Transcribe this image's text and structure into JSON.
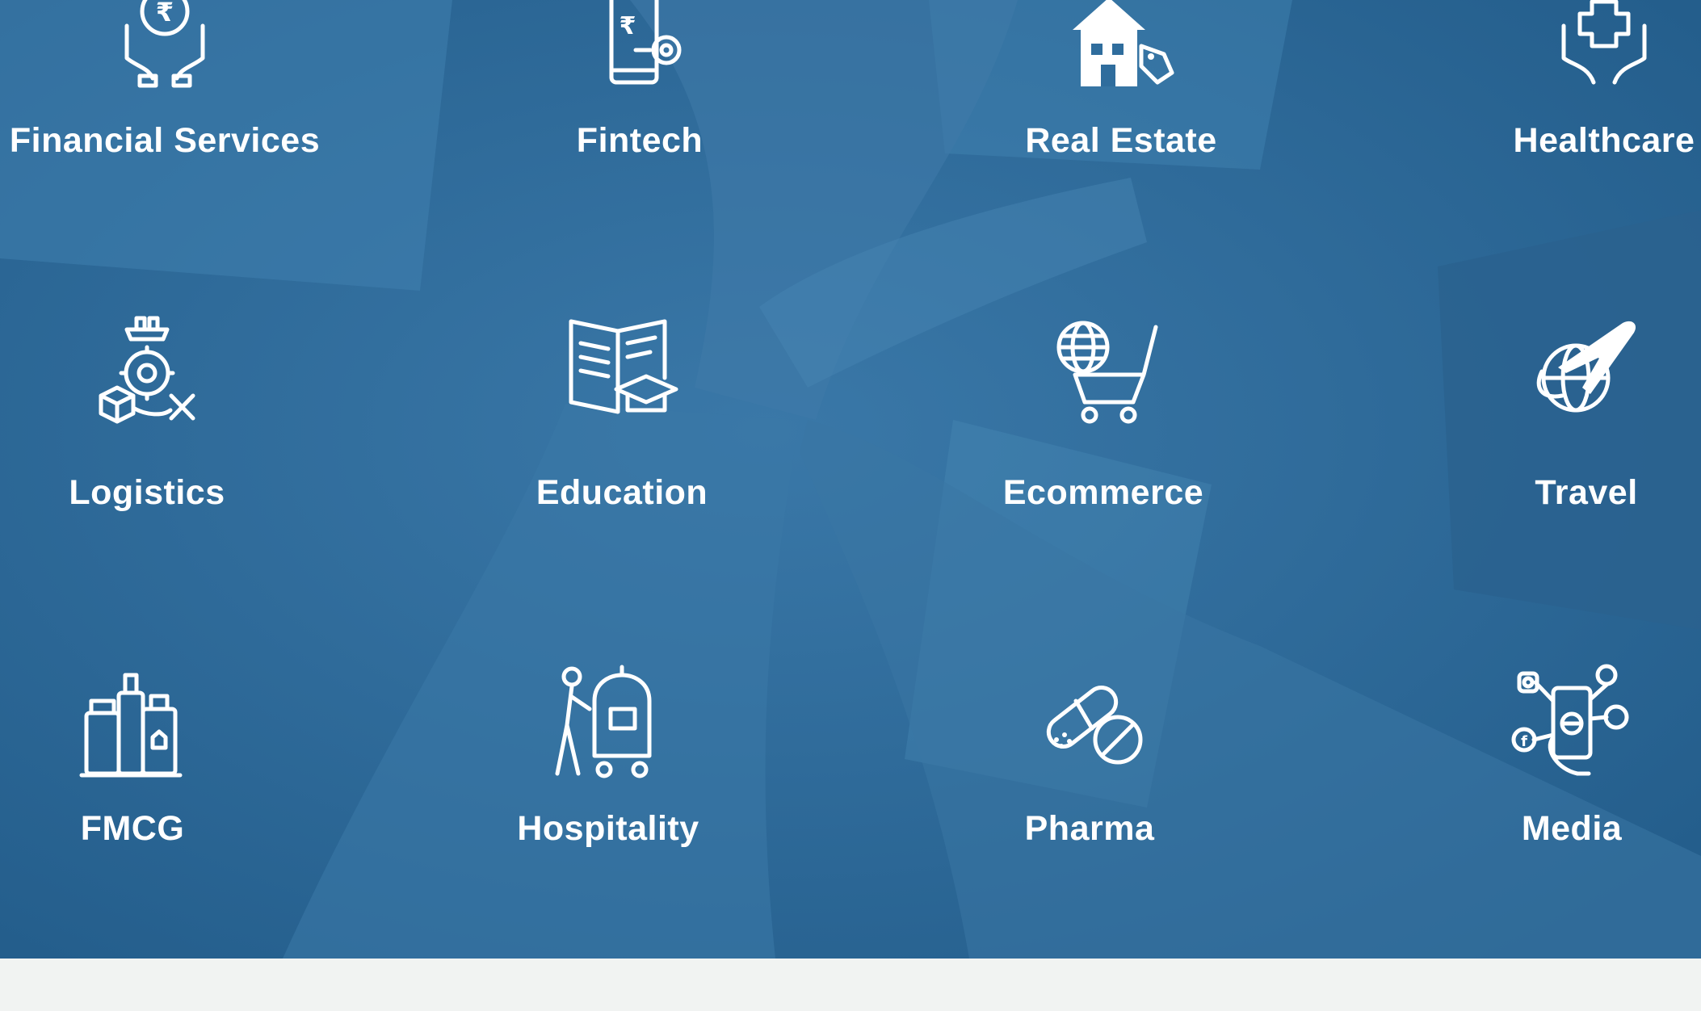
{
  "industries": [
    {
      "label": "Financial Services",
      "icon": "rupee-hands-icon"
    },
    {
      "label": "Fintech",
      "icon": "fintech-phone-gear-icon"
    },
    {
      "label": "Real Estate",
      "icon": "house-tag-icon"
    },
    {
      "label": "Healthcare",
      "icon": "healthcare-hands-icon"
    },
    {
      "label": "Logistics",
      "icon": "logistics-gear-icon"
    },
    {
      "label": "Education",
      "icon": "book-graduation-cap-icon"
    },
    {
      "label": "Ecommerce",
      "icon": "globe-cart-icon"
    },
    {
      "label": "Travel",
      "icon": "globe-airplane-icon"
    },
    {
      "label": "FMCG",
      "icon": "products-bottles-icon"
    },
    {
      "label": "Hospitality",
      "icon": "bellhop-cart-icon"
    },
    {
      "label": "Pharma",
      "icon": "pills-capsule-icon"
    },
    {
      "label": "Media",
      "icon": "social-media-phone-icon"
    }
  ],
  "colors": {
    "overlay": "#2f6d9d",
    "text": "#ffffff",
    "footer": "#f1f3f2"
  }
}
